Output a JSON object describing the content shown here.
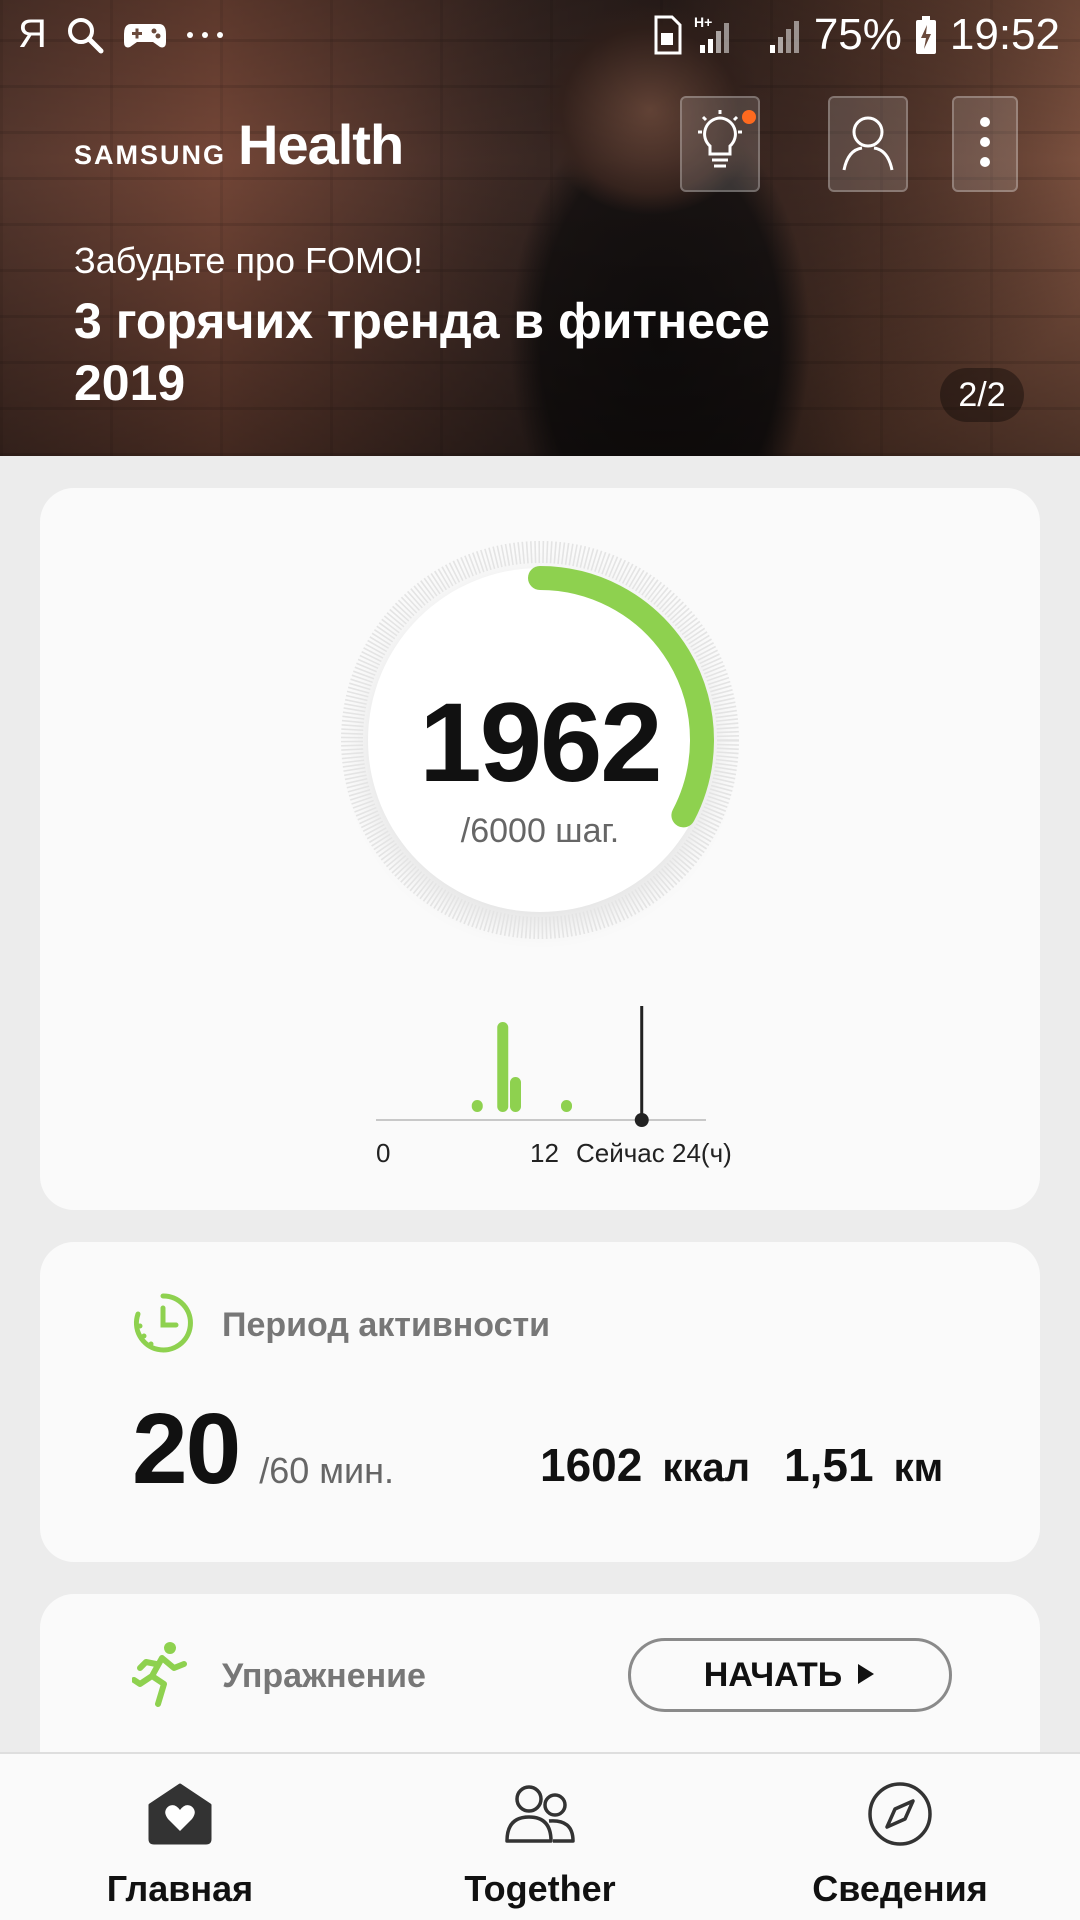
{
  "status_bar": {
    "left_letter": "Я",
    "battery": "75%",
    "time": "19:52",
    "network": "H+"
  },
  "header": {
    "brand_samsung": "SAMSUNG",
    "brand_health": "Health",
    "notification_dot_color": "#ff6a1f"
  },
  "hero": {
    "subtitle": "Забудьте про FOMO!",
    "title": "3 горячих тренда в фитнесе 2019",
    "pager": "2/2"
  },
  "steps": {
    "value": "1962",
    "goal": "/6000 шаг.",
    "progress_fraction": 0.327,
    "accent_color": "#8ed14f",
    "hourly_axis": {
      "start": "0",
      "mid": "12",
      "now": "Сейчас",
      "end": "24(ч)"
    },
    "hourly_bars": [
      {
        "hour": 7,
        "level": 0.12
      },
      {
        "hour": 9,
        "level": 0.9
      },
      {
        "hour": 10,
        "level": 0.35
      },
      {
        "hour": 14,
        "level": 0.12
      }
    ],
    "now_hour": 19.9
  },
  "activity": {
    "label": "Период активности",
    "minutes": "20",
    "minutes_goal": "/60 мин.",
    "kcal_value": "1602",
    "kcal_unit": "ккал",
    "distance_value": "1,51",
    "distance_unit": "км"
  },
  "exercise": {
    "label": "Упражнение",
    "start_label": "НАЧАТЬ"
  },
  "bottom_nav": [
    {
      "label": "Главная",
      "icon": "home-heart-icon"
    },
    {
      "label": "Together",
      "icon": "people-icon"
    },
    {
      "label": "Сведения",
      "icon": "compass-icon"
    }
  ]
}
